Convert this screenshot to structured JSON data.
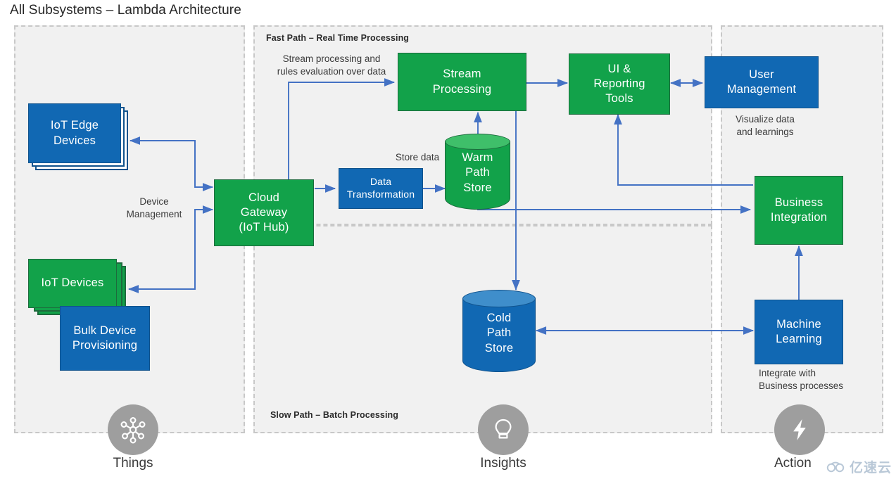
{
  "page": {
    "title": "All Subsystems – Lambda Architecture"
  },
  "zones": {
    "things": {
      "label": ""
    },
    "fast_path": {
      "label": "Fast Path – Real Time Processing"
    },
    "slow_path": {
      "label": "Slow Path – Batch Processing"
    },
    "action": {
      "label": ""
    }
  },
  "nodes": {
    "iot_edge_devices": {
      "label": "IoT Edge\nDevices",
      "color": "#1168B3",
      "style": "stacked-blue"
    },
    "iot_devices": {
      "label": "IoT Devices",
      "color": "#12A24A",
      "style": "stacked-green"
    },
    "bulk_device_provisioning": {
      "label": "Bulk Device\nProvisioning",
      "color": "#1168B3"
    },
    "cloud_gateway": {
      "label": "Cloud\nGateway\n(IoT Hub)",
      "color": "#12A24A"
    },
    "data_transformation": {
      "label": "Data\nTransformation",
      "color": "#1168B3"
    },
    "stream_processing": {
      "label": "Stream\nProcessing",
      "color": "#12A24A"
    },
    "warm_path_store": {
      "label": "Warm\nPath\nStore",
      "color": "#12A24A",
      "style": "cylinder"
    },
    "cold_path_store": {
      "label": "Cold\nPath\nStore",
      "color": "#1168B3",
      "style": "cylinder"
    },
    "ui_reporting_tools": {
      "label": "UI &\nReporting\nTools",
      "color": "#12A24A"
    },
    "user_management": {
      "label": "User\nManagement",
      "color": "#1168B3"
    },
    "business_integration": {
      "label": "Business\nIntegration",
      "color": "#12A24A"
    },
    "machine_learning": {
      "label": "Machine\nLearning",
      "color": "#1168B3"
    }
  },
  "annotations": {
    "stream_rules": "Stream processing and\nrules evaluation over data",
    "device_management": "Device\nManagement",
    "store_data": "Store data",
    "visualize": "Visualize data\nand learnings",
    "integrate": "Integrate with\nBusiness processes"
  },
  "personas": [
    {
      "label": "Things",
      "icon": "network-nodes-icon"
    },
    {
      "label": "Insights",
      "icon": "lightbulb-icon"
    },
    {
      "label": "Action",
      "icon": "lightning-bolt-icon"
    }
  ],
  "watermark": {
    "text": "亿速云"
  },
  "colors": {
    "green": "#12A24A",
    "blue": "#1168B3",
    "connector": "#4472C4",
    "zone_fill": "#f1f1f1",
    "zone_border": "#c8c8c8",
    "persona_gray": "#9e9e9e"
  }
}
